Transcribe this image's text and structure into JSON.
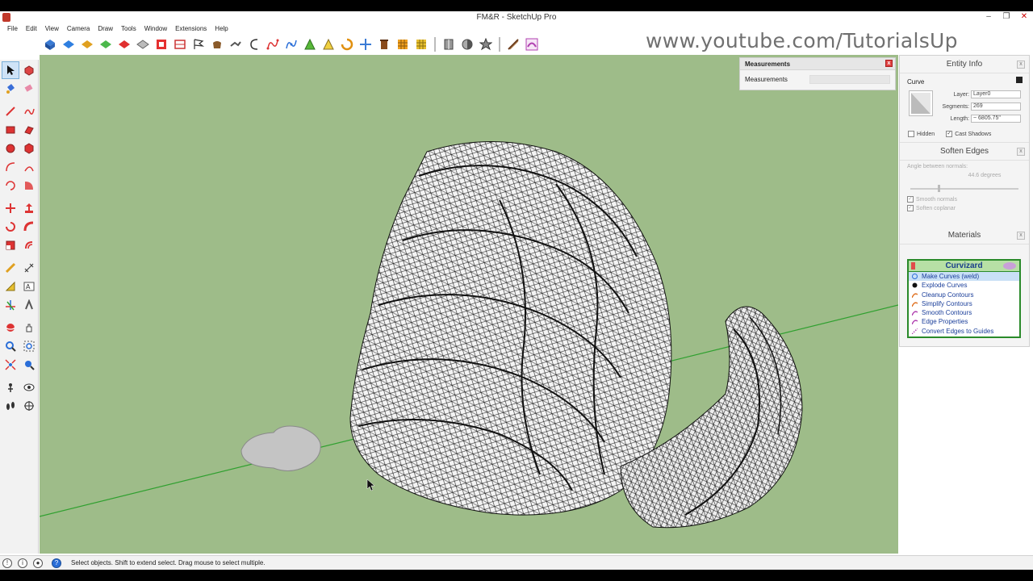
{
  "window": {
    "title": "FM&R - SketchUp Pro",
    "controls": {
      "minimize": "–",
      "restore": "❐",
      "close": "✕"
    }
  },
  "menu": [
    "File",
    "Edit",
    "View",
    "Camera",
    "Draw",
    "Tools",
    "Window",
    "Extensions",
    "Help"
  ],
  "watermark": "www.youtube.com/TutorialsUp",
  "measurements": {
    "title": "Measurements",
    "label": "Measurements",
    "close": "x"
  },
  "entity_info": {
    "title": "Entity Info",
    "type": "Curve",
    "layer_label": "Layer:",
    "layer_value": "Layer0",
    "segments_label": "Segments:",
    "segments_value": "269",
    "length_label": "Length:",
    "length_value": "~ 6805.75\"",
    "hidden_label": "Hidden",
    "cast_shadows_label": "Cast Shadows",
    "close": "x"
  },
  "soften_edges": {
    "title": "Soften Edges",
    "angle_label": "Angle between normals:",
    "angle_value": "44.6",
    "angle_unit": "degrees",
    "smooth_normals": "Smooth normals",
    "soften_coplanar": "Soften coplanar",
    "close": "x"
  },
  "materials": {
    "title": "Materials",
    "close": "x"
  },
  "curvizard": {
    "title": "Curvizard",
    "items": [
      "Make Curves (weld)",
      "Explode Curves",
      "Cleanup Contours",
      "Simplify Contours",
      "Smooth Contours",
      "Edge Properties",
      "Convert Edges to Guides"
    ]
  },
  "status": {
    "message": "Select objects. Shift to extend select. Drag mouse to select multiple.",
    "icons": [
      "info-icon",
      "credit-icon",
      "user-icon",
      "help-icon"
    ]
  },
  "colors": {
    "viewport_bg": "#9ebc89",
    "axis_green": "#2fa02f",
    "curvizard_border": "#2a8a2a",
    "curvizard_header": "#b7e0a5"
  }
}
